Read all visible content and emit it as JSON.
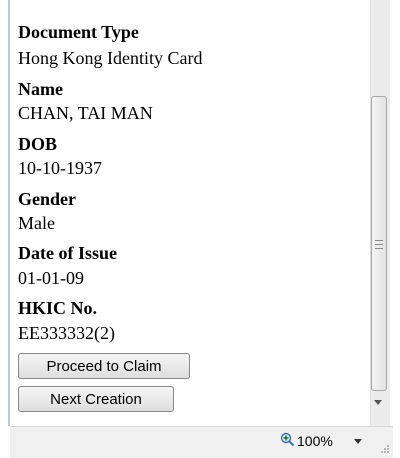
{
  "fields": [
    {
      "label": "Document Type",
      "value": "Hong Kong Identity Card"
    },
    {
      "label": "Name",
      "value": "CHAN, TAI MAN"
    },
    {
      "label": "DOB",
      "value": "10-10-1937"
    },
    {
      "label": "Gender",
      "value": "Male"
    },
    {
      "label": "Date of Issue",
      "value": "01-01-09"
    },
    {
      "label": "HKIC No.",
      "value": "EE333332(2)"
    }
  ],
  "buttons": {
    "proceed": "Proceed to Claim",
    "next": "Next Creation"
  },
  "statusbar": {
    "zoom": "100%"
  },
  "icons": {
    "zoom": "zoom-in-icon",
    "zoom_dropdown": "chevron-down-icon",
    "scroll_down": "scroll-down-arrow-icon"
  }
}
